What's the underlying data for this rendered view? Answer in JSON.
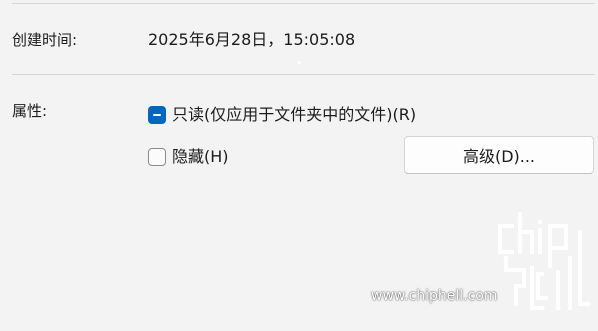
{
  "created": {
    "label": "创建时间:",
    "value": "2025年6月28日，15:05:08"
  },
  "attributes": {
    "label": "属性:",
    "readonly": {
      "label": "只读(仅应用于文件夹中的文件)(R)",
      "state": "indeterminate"
    },
    "hidden": {
      "label": "隐藏(H)",
      "state": "unchecked"
    },
    "advanced_button": "高级(D)..."
  },
  "watermark": {
    "logo_text": "chiphell",
    "url": "www.chiphell.com"
  },
  "colors": {
    "accent": "#0067c0",
    "background": "#f3f3f3"
  }
}
